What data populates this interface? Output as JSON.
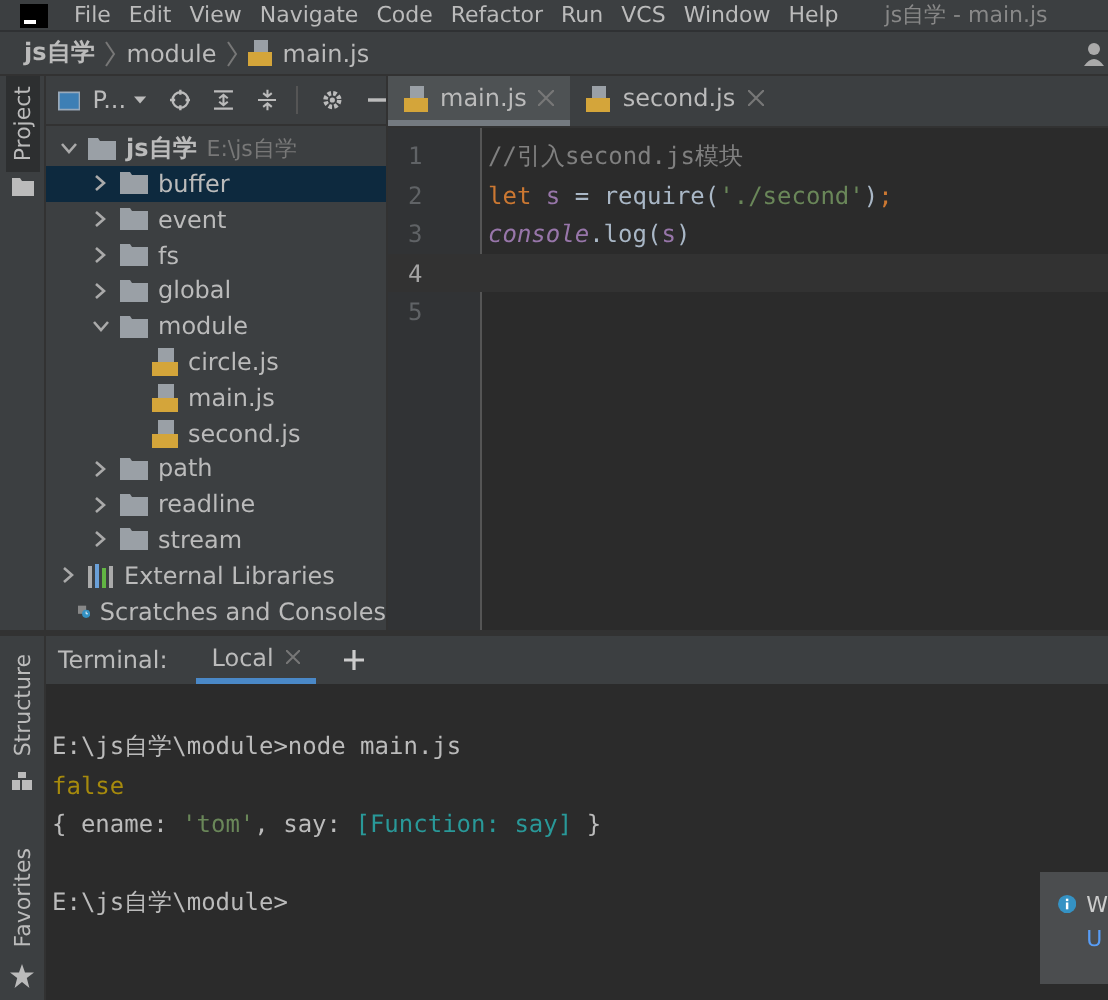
{
  "menu_bar": {
    "items": [
      "File",
      "Edit",
      "View",
      "Navigate",
      "Code",
      "Refactor",
      "Run",
      "VCS",
      "Window",
      "Help"
    ],
    "title": "js自学 - main.js"
  },
  "breadcrumbs": [
    {
      "label": "js自学",
      "kind": "project"
    },
    {
      "label": "module",
      "kind": "folder"
    },
    {
      "label": "main.js",
      "kind": "file"
    }
  ],
  "left_stripe": {
    "top": "Project",
    "bottom": [
      "Structure",
      "Favorites"
    ]
  },
  "project_panel": {
    "title": "P...",
    "tree": [
      {
        "label": "js自学",
        "path": "E:\\js自学",
        "kind": "folder",
        "expanded": true,
        "selected": false,
        "children": [
          {
            "label": "buffer",
            "kind": "folder",
            "expanded": false,
            "selected": true
          },
          {
            "label": "event",
            "kind": "folder",
            "expanded": false,
            "selected": false
          },
          {
            "label": "fs",
            "kind": "folder",
            "expanded": false,
            "selected": false
          },
          {
            "label": "global",
            "kind": "folder",
            "expanded": false,
            "selected": false
          },
          {
            "label": "module",
            "kind": "folder",
            "expanded": true,
            "selected": false,
            "children": [
              {
                "label": "circle.js",
                "kind": "js",
                "selected": false
              },
              {
                "label": "main.js",
                "kind": "js",
                "selected": false
              },
              {
                "label": "second.js",
                "kind": "js",
                "selected": false
              }
            ]
          },
          {
            "label": "path",
            "kind": "folder",
            "expanded": false,
            "selected": false
          },
          {
            "label": "readline",
            "kind": "folder",
            "expanded": false,
            "selected": false
          },
          {
            "label": "stream",
            "kind": "folder",
            "expanded": false,
            "selected": false
          }
        ]
      },
      {
        "label": "External Libraries",
        "kind": "libraries",
        "expanded": false,
        "selected": false
      },
      {
        "label": "Scratches and Consoles",
        "kind": "scratches",
        "selected": false
      }
    ]
  },
  "editor": {
    "tabs": [
      {
        "label": "main.js",
        "selected": true
      },
      {
        "label": "second.js",
        "selected": false
      }
    ],
    "lines": [
      {
        "number": "1",
        "current": false,
        "tokens": [
          {
            "text": "//引入second.js模块",
            "kind": "comment"
          }
        ]
      },
      {
        "number": "2",
        "current": false,
        "tokens": [
          {
            "text": "let",
            "kind": "keyword"
          },
          {
            "text": " s",
            "kind": "var"
          },
          {
            "text": " = require(",
            "kind": "plain"
          },
          {
            "text": "'./second'",
            "kind": "string"
          },
          {
            "text": ")",
            "kind": "plain"
          },
          {
            "text": ";",
            "kind": "keyword"
          }
        ]
      },
      {
        "number": "3",
        "current": false,
        "tokens": [
          {
            "text": "console",
            "kind": "global"
          },
          {
            "text": ".log(",
            "kind": "plain"
          },
          {
            "text": "s",
            "kind": "var"
          },
          {
            "text": ")",
            "kind": "plain"
          }
        ]
      },
      {
        "number": "4",
        "current": true
      },
      {
        "number": "5",
        "current": false
      }
    ]
  },
  "terminal": {
    "label": "Terminal:",
    "tabs": [
      {
        "label": "Local",
        "selected": true
      }
    ],
    "lines": [
      {
        "kind": "prompt",
        "segments": [
          {
            "text": "E:\\js自学\\module>node main.js",
            "kind": "plain"
          }
        ]
      },
      {
        "kind": "output",
        "segments": [
          {
            "text": "false",
            "kind": "boolean"
          }
        ]
      },
      {
        "kind": "output",
        "segments": [
          {
            "text": "{ ename: ",
            "kind": "plain"
          },
          {
            "text": "'tom'",
            "kind": "string"
          },
          {
            "text": ", say: ",
            "kind": "plain"
          },
          {
            "text": "[Function: say]",
            "kind": "special"
          },
          {
            "text": " }",
            "kind": "plain"
          }
        ]
      },
      {
        "kind": "prompt",
        "segments": [
          {
            "text": "E:\\js自学\\module>",
            "kind": "plain"
          }
        ]
      }
    ]
  },
  "notification": {
    "title": "W",
    "link": "U"
  }
}
